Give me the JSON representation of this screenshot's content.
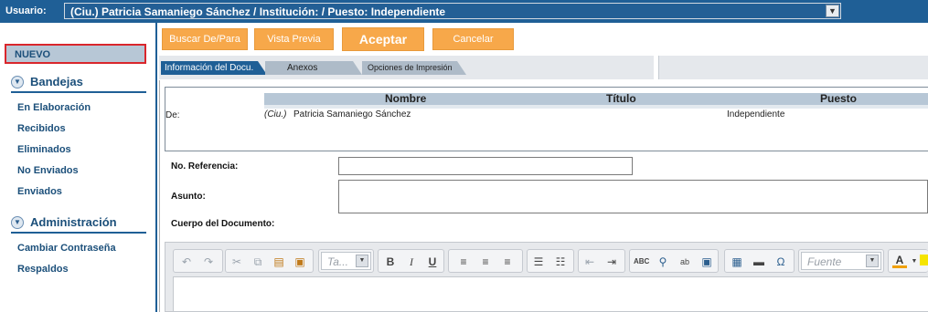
{
  "topbar": {
    "user_label": "Usuario:",
    "user_value": "(Ciu.) Patricia Samaniego Sánchez / Institución:              / Puesto: Independiente"
  },
  "sidebar": {
    "nuevo": "NUEVO",
    "bandejas_title": "Bandejas",
    "bandejas_items": [
      "En Elaboración",
      "Recibidos",
      "Eliminados",
      "No Enviados",
      "Enviados"
    ],
    "admin_title": "Administración",
    "admin_items": [
      "Cambiar Contraseña",
      "Respaldos"
    ]
  },
  "toolbar": {
    "buscar": "Buscar De/Para",
    "vista": "Vista Previa",
    "aceptar": "Aceptar",
    "cancelar": "Cancelar"
  },
  "tabs": [
    "Información del Docu.",
    "Anexos",
    "Opciones de Impresión"
  ],
  "recipients": {
    "headers": [
      "Nombre",
      "Título",
      "Puesto"
    ],
    "de_label": "De:",
    "prefix": "(Ciu.)",
    "name": "Patricia Samaniego Sánchez",
    "puesto": "Independiente"
  },
  "form": {
    "referencia_label": "No. Referencia:",
    "referencia_value": "",
    "asunto_label": "Asunto:",
    "asunto_value": "",
    "cuerpo_label": "Cuerpo del Documento:"
  },
  "editor": {
    "size_placeholder": "Ta...",
    "font_placeholder": "Fuente"
  },
  "colors": {
    "brand_blue": "#1f5f96",
    "button_orange": "#f7a84a",
    "highlight_red": "#d9262c"
  }
}
